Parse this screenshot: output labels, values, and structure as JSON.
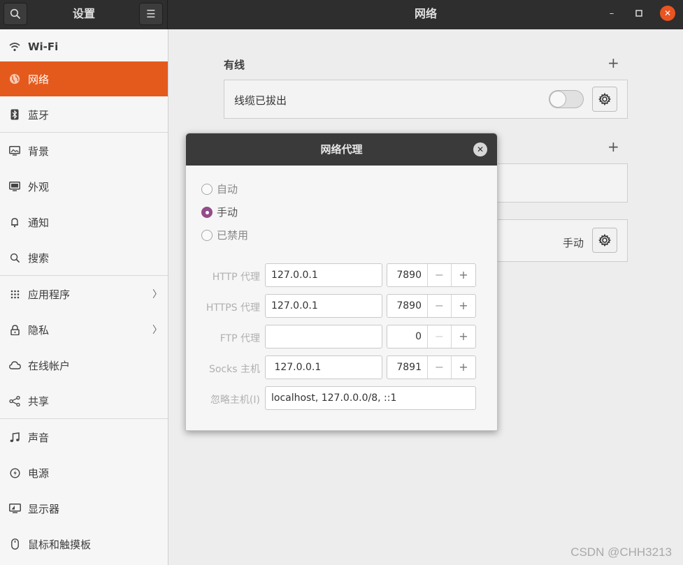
{
  "header": {
    "sidebar_title": "设置",
    "main_title": "网络",
    "minimize_glyph": "–",
    "maximize_glyph": "☐",
    "close_glyph": "✕",
    "menu_glyph": "☰"
  },
  "sidebar": {
    "items": [
      {
        "label": "Wi-Fi",
        "icon": "wifi-icon"
      },
      {
        "label": "网络",
        "icon": "network-icon",
        "active": true
      },
      {
        "label": "蓝牙",
        "icon": "bluetooth-icon"
      },
      {
        "label": "背景",
        "icon": "background-icon"
      },
      {
        "label": "外观",
        "icon": "appearance-icon"
      },
      {
        "label": "通知",
        "icon": "bell-icon"
      },
      {
        "label": "搜索",
        "icon": "search-icon"
      },
      {
        "label": "应用程序",
        "icon": "apps-grid-icon",
        "chevron": "〉"
      },
      {
        "label": "隐私",
        "icon": "lock-icon",
        "chevron": "〉"
      },
      {
        "label": "在线帐户",
        "icon": "cloud-icon"
      },
      {
        "label": "共享",
        "icon": "share-icon"
      },
      {
        "label": "声音",
        "icon": "music-note-icon"
      },
      {
        "label": "电源",
        "icon": "power-icon"
      },
      {
        "label": "显示器",
        "icon": "display-icon"
      },
      {
        "label": "鼠标和触摸板",
        "icon": "mouse-icon"
      }
    ]
  },
  "main": {
    "wired_title": "有线",
    "add_glyph": "+",
    "wired_status": "线缆已拔出",
    "proxy_value": "手动"
  },
  "dialog": {
    "title": "网络代理",
    "close_glyph": "✕",
    "modes": [
      {
        "label": "自动",
        "checked": false
      },
      {
        "label": "手动",
        "checked": true
      },
      {
        "label": "已禁用",
        "checked": false
      }
    ],
    "fields": {
      "http": {
        "label": "HTTP 代理",
        "host": "127.0.0.1",
        "port": "7890"
      },
      "https": {
        "label": "HTTPS 代理",
        "host": "127.0.0.1",
        "port": "7890"
      },
      "ftp": {
        "label": "FTP 代理",
        "host": "",
        "port": "0"
      },
      "socks": {
        "label": "Socks 主机",
        "host": " 127.0.0.1",
        "port": "7891"
      },
      "ignore": {
        "label": "忽略主机(I)",
        "value": "localhost, 127.0.0.0/8, ::1"
      }
    },
    "minus_glyph": "−",
    "plus_glyph": "+"
  },
  "watermark": "CSDN @CHH3213",
  "colors": {
    "accent": "#e45a1c",
    "radio_checked": "#924d8b",
    "headerbar": "#2e2e2e"
  }
}
